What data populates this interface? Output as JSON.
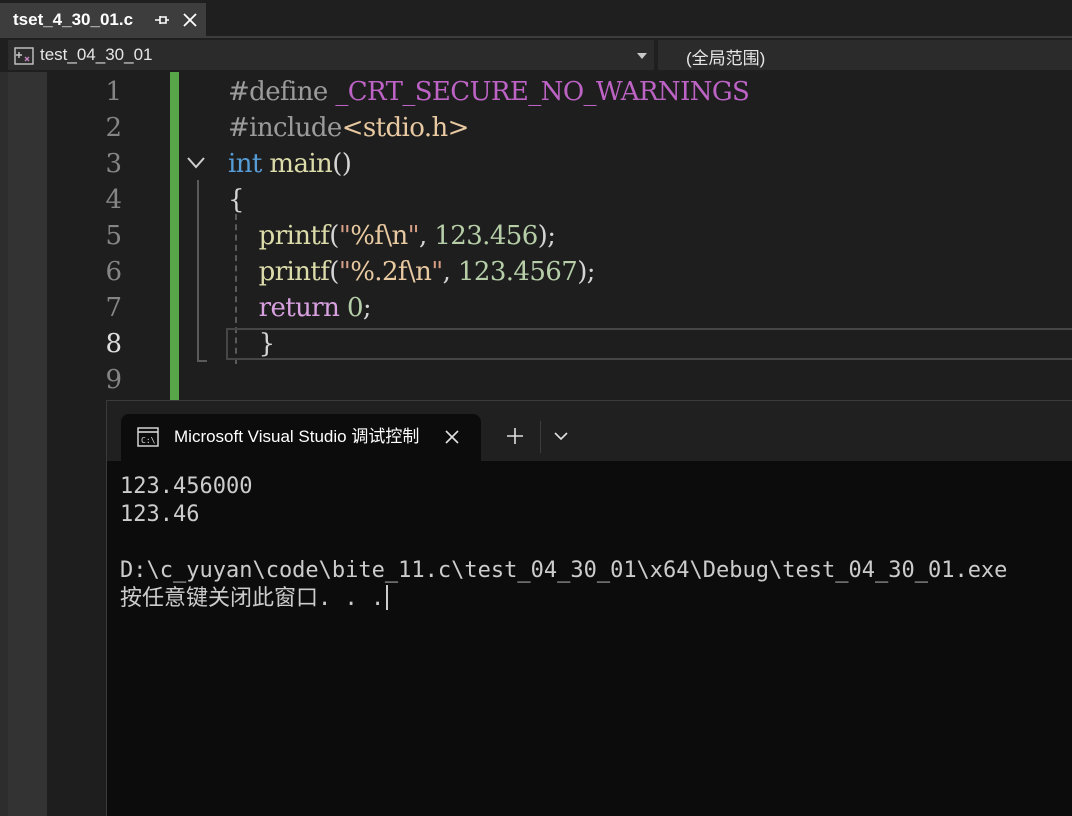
{
  "tab": {
    "title": "tset_4_30_01.c",
    "pin_icon": "pin-icon",
    "close_icon": "close-icon"
  },
  "navbar": {
    "project_icon": "project-icon",
    "project_name": "test_04_30_01",
    "scope": "(全局范围)"
  },
  "editor": {
    "line_numbers": [
      "1",
      "2",
      "3",
      "4",
      "5",
      "6",
      "7",
      "8",
      "9"
    ],
    "current_line": 8,
    "lines": [
      [
        {
          "t": "#define ",
          "c": "pre"
        },
        {
          "t": "_CRT_SECURE_NO_WARNINGS",
          "c": "macro"
        }
      ],
      [
        {
          "t": "#include",
          "c": "pre"
        },
        {
          "t": "<stdio.h>",
          "c": "inc"
        }
      ],
      [
        {
          "t": "int",
          "c": "kw"
        },
        {
          "t": " ",
          "c": "pun"
        },
        {
          "t": "main",
          "c": "fn"
        },
        {
          "t": "()",
          "c": "pun"
        }
      ],
      [
        {
          "t": "{",
          "c": "pun"
        }
      ],
      [
        {
          "t": "    ",
          "c": "pun"
        },
        {
          "t": "printf",
          "c": "fn"
        },
        {
          "t": "(",
          "c": "pun"
        },
        {
          "t": "\"",
          "c": "str"
        },
        {
          "t": "%f\\n",
          "c": "esc"
        },
        {
          "t": "\"",
          "c": "str"
        },
        {
          "t": ", ",
          "c": "pun"
        },
        {
          "t": "123.456",
          "c": "num"
        },
        {
          "t": ");",
          "c": "pun"
        }
      ],
      [
        {
          "t": "    ",
          "c": "pun"
        },
        {
          "t": "printf",
          "c": "fn"
        },
        {
          "t": "(",
          "c": "pun"
        },
        {
          "t": "\"",
          "c": "str"
        },
        {
          "t": "%.2f\\n",
          "c": "esc"
        },
        {
          "t": "\"",
          "c": "str"
        },
        {
          "t": ", ",
          "c": "pun"
        },
        {
          "t": "123.4567",
          "c": "num"
        },
        {
          "t": ");",
          "c": "pun"
        }
      ],
      [
        {
          "t": "    ",
          "c": "pun"
        },
        {
          "t": "return",
          "c": "ret"
        },
        {
          "t": " ",
          "c": "pun"
        },
        {
          "t": "0",
          "c": "num"
        },
        {
          "t": ";",
          "c": "pun"
        }
      ],
      [
        {
          "t": "    ",
          "c": "pun"
        },
        {
          "t": "}",
          "c": "pun"
        }
      ],
      []
    ],
    "fold_icon": "chevron-down-icon",
    "colors": {
      "change_bar": "#57a64a",
      "keyword": "#569cd6",
      "function": "#dcdcaa",
      "macro": "#bd63c5",
      "number": "#b5cea8"
    }
  },
  "console": {
    "app_icon": "console-icon",
    "tab_title": "Microsoft Visual Studio 调试控制台",
    "close_icon": "close-icon",
    "new_tab_icon": "plus-icon",
    "dropdown_icon": "chevron-down-icon",
    "output": [
      "123.456000",
      "123.46",
      "",
      "D:\\c_yuyan\\code\\bite_11.c\\test_04_30_01\\x64\\Debug\\test_04_30_01.exe",
      "按任意键关闭此窗口. . ."
    ]
  }
}
